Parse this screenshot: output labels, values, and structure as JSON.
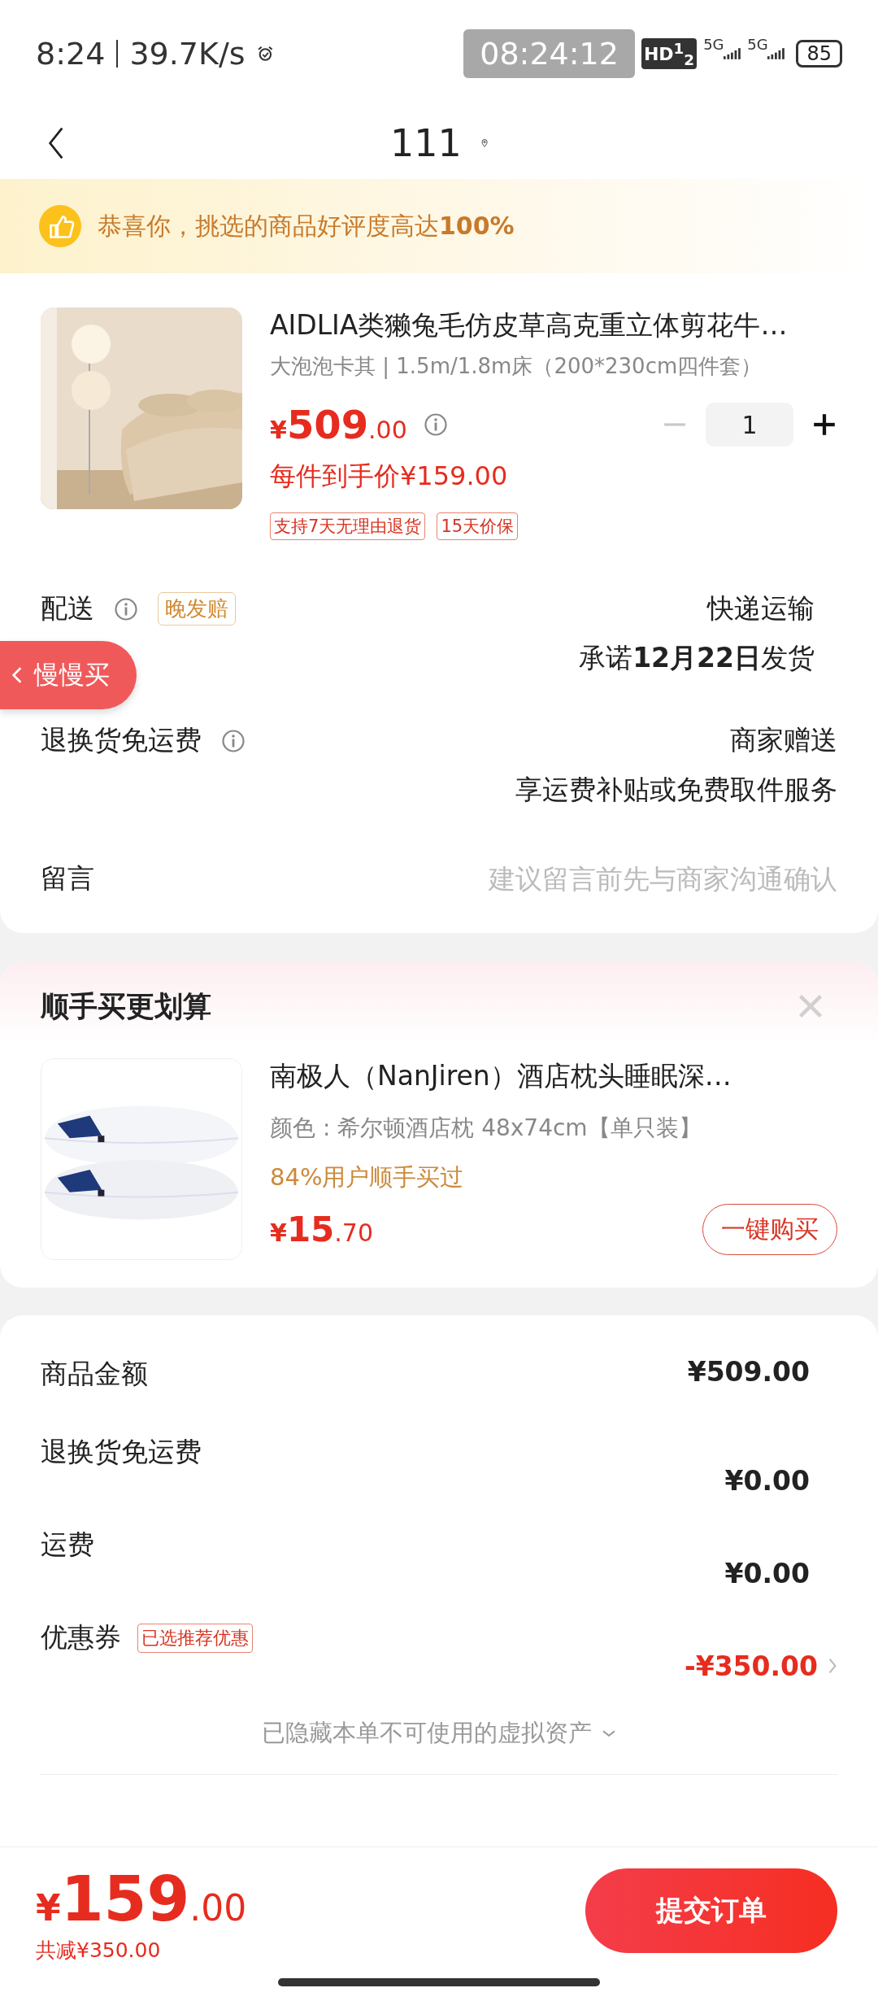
{
  "status_bar": {
    "time": "8:24",
    "net_speed": "39.7K/s",
    "clock_overlay": "08:24:12",
    "hd_badge": "HD$^{1}$$_{2}$",
    "network_1": "5G",
    "network_2": "5G",
    "battery": "85"
  },
  "nav": {
    "title": "111"
  },
  "banner": {
    "text": "恭喜你，挑选的商品好评度高达**100%**"
  },
  "product": {
    "title": "AIDLIA类獭兔毛仿皮草高克重立体剪花牛…",
    "spec": "大泡泡卡其 | 1.5m/1.8m床（200*230cm四件套）",
    "price_symbol": "¥",
    "price_int": "509",
    "price_dec": ".00",
    "per_price": "每件到手价¥159.00",
    "quantity": "1",
    "minus_disabled": true,
    "tags": [
      "支持7天无理由退货",
      "15天价保"
    ]
  },
  "delivery": {
    "label": "配送",
    "badge": "晚发赔",
    "method": "快递运输",
    "promise": "承诺**12月22日**发货"
  },
  "floating_button": {
    "label": "慢慢买"
  },
  "return_shipping": {
    "label": "退换货免运费",
    "value": "商家赠送",
    "note": "享运费补贴或免费取件服务"
  },
  "message": {
    "label": "留言",
    "placeholder": "建议留言前先与商家沟通确认"
  },
  "addon": {
    "title": "顺手买更划算",
    "item": {
      "title": "南极人（NanJiren）酒店枕头睡眠深…",
      "spec": "颜色 : 希尔顿酒店枕 48x74cm【单只装】",
      "social": "84%用户顺手买过",
      "price_symbol": "¥",
      "price_int": "15",
      "price_dec": ".70",
      "button": "一键购买"
    }
  },
  "summary": {
    "rows": [
      {
        "label": "商品金额",
        "value": "¥509.00",
        "kind": "plain"
      },
      {
        "label": "退换货免运费",
        "value": "¥0.00",
        "kind": "plain"
      },
      {
        "label": "运费",
        "value": "¥0.00",
        "kind": "plain"
      },
      {
        "label": "优惠券",
        "tag": "已选推荐优惠",
        "value": "-¥350.00",
        "kind": "discount"
      }
    ],
    "hidden_note": "已隐藏本单不可使用的虚拟资产"
  },
  "footer": {
    "price_symbol": "¥",
    "price_int": "159",
    "price_dec": ".00",
    "saved": "共减¥350.00",
    "submit": "提交订单"
  }
}
